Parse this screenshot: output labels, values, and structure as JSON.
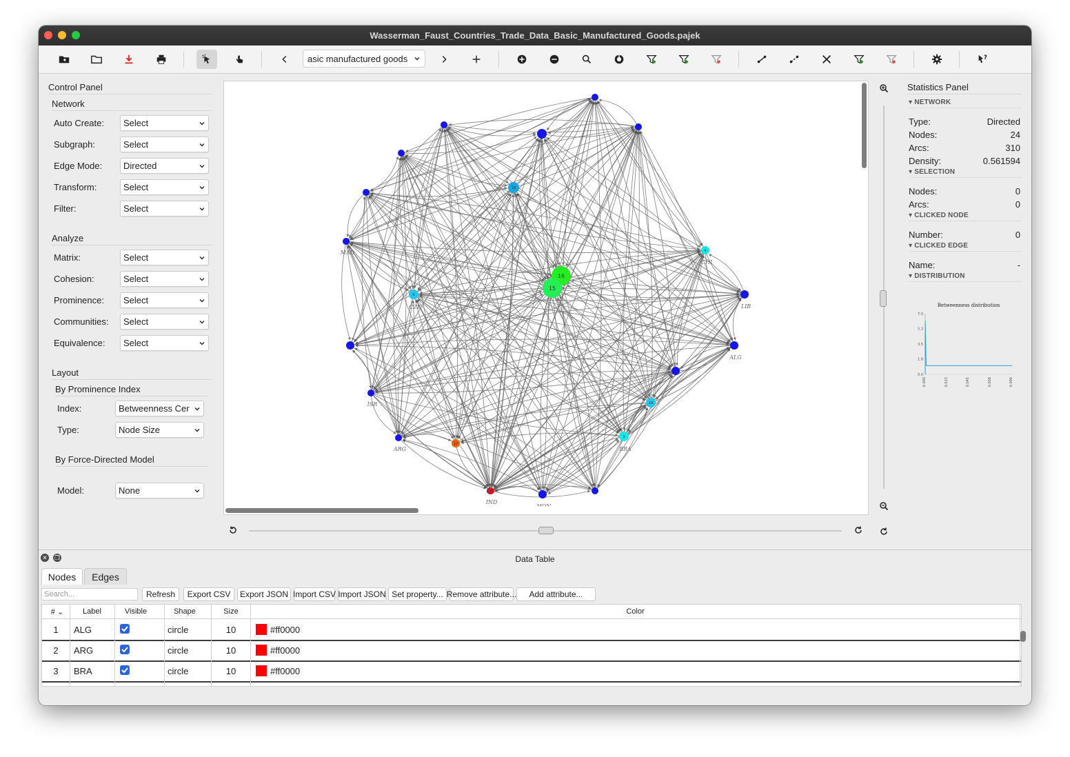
{
  "window": {
    "title": "Wasserman_Faust_Countries_Trade_Data_Basic_Manufactured_Goods.pajek"
  },
  "toolbar": {
    "network_select": "asic manufactured goods"
  },
  "control_panel": {
    "title": "Control Panel",
    "network": {
      "heading": "Network",
      "rows": [
        {
          "label": "Auto Create:",
          "value": "Select"
        },
        {
          "label": "Subgraph:",
          "value": "Select"
        },
        {
          "label": "Edge Mode:",
          "value": "Directed"
        },
        {
          "label": "Transform:",
          "value": "Select"
        },
        {
          "label": "Filter:",
          "value": "Select"
        }
      ]
    },
    "analyze": {
      "heading": "Analyze",
      "rows": [
        {
          "label": "Matrix:",
          "value": "Select"
        },
        {
          "label": "Cohesion:",
          "value": "Select"
        },
        {
          "label": "Prominence:",
          "value": "Select"
        },
        {
          "label": "Communities:",
          "value": "Select"
        },
        {
          "label": "Equivalence:",
          "value": "Select"
        }
      ]
    },
    "layout": {
      "heading": "Layout",
      "by_prominence": "By Prominence Index",
      "index_label": "Index:",
      "index_value": "Betweenness Cer",
      "type_label": "Type:",
      "type_value": "Node Size",
      "by_force": "By Force-Directed Model",
      "model_label": "Model:",
      "model_value": "None"
    }
  },
  "graph": {
    "nodes": [
      {
        "label": "",
        "num": "",
        "color": "#1616e6"
      },
      {
        "label": "",
        "num": "",
        "color": "#1616e6"
      },
      {
        "label": "",
        "num": "",
        "color": "#1616e6"
      },
      {
        "label": "",
        "num": "",
        "color": "#1616e6"
      },
      {
        "label": "",
        "num": "",
        "color": "#1616e6"
      },
      {
        "label": "MAD",
        "num": "",
        "color": "#1616e6"
      },
      {
        "label": "LIB",
        "num": "",
        "color": "#1616e6"
      },
      {
        "label": "",
        "num": "",
        "color": "#1616e6"
      },
      {
        "label": "ALG",
        "num": "",
        "color": "#1616e6"
      },
      {
        "label": "ISR",
        "num": "",
        "color": "#1616e6"
      },
      {
        "label": "ARG",
        "num": "",
        "color": "#1616e6"
      },
      {
        "label": "IND",
        "num": "",
        "color": "#1616e6"
      },
      {
        "label": "HON",
        "num": "",
        "color": "#1616e6"
      },
      {
        "label": "",
        "num": "",
        "color": "#1616e6"
      },
      {
        "label": "",
        "num": "",
        "color": "#1616e6"
      },
      {
        "label": "",
        "num": "",
        "color": "#1616e6"
      },
      {
        "label": "",
        "num": "19",
        "color": "#22c7ee"
      },
      {
        "label": "BRA",
        "num": "3",
        "color": "#18e6e6"
      },
      {
        "label": "CHI",
        "num": "4",
        "color": "#18e6e6"
      },
      {
        "label": "CZE",
        "num": "5",
        "color": "#22c7ee"
      },
      {
        "label": "",
        "num": "18",
        "color": "#1aa6e0"
      },
      {
        "label": "",
        "num": "16",
        "color": "#22ee22"
      },
      {
        "label": "",
        "num": "15",
        "color": "#22ee55"
      },
      {
        "label": "",
        "num": "22",
        "color": "#f2600c"
      },
      {
        "label": "",
        "num": "23",
        "color": "#f01414"
      }
    ]
  },
  "stats": {
    "title": "Statistics Panel",
    "network_header": "▾ NETWORK",
    "network_rows": [
      {
        "k": "Type:",
        "v": "Directed"
      },
      {
        "k": "Nodes:",
        "v": "24"
      },
      {
        "k": "Arcs:",
        "v": "310"
      },
      {
        "k": "Density:",
        "v": "0.561594"
      }
    ],
    "selection_header": "▾ SELECTION",
    "selection_rows": [
      {
        "k": "Nodes:",
        "v": "0"
      },
      {
        "k": "Arcs:",
        "v": "0"
      }
    ],
    "clicked_node_header": "▾ CLICKED NODE",
    "clicked_node_rows": [
      {
        "k": "Number:",
        "v": "0"
      }
    ],
    "clicked_edge_header": "▾ CLICKED EDGE",
    "clicked_edge_rows": [
      {
        "k": "Name:",
        "v": "-"
      }
    ],
    "distribution_header": "▾ DISTRIBUTION"
  },
  "chart_data": {
    "type": "line",
    "title": "Betweenness distribution",
    "x": [
      0.0,
      0.0,
      0.001,
      0.09
    ],
    "y": [
      0.0,
      6.2,
      1.0,
      1.0
    ],
    "xlim": [
      0.0,
      0.09
    ],
    "ylim": [
      0.0,
      7.0
    ],
    "xticks": [
      "0.000",
      "0.023",
      "0.045",
      "0.068",
      "0.090"
    ],
    "yticks": [
      "0.0",
      "1.8",
      "3.5",
      "5.3",
      "7.0"
    ],
    "line_color": "#2a9fd6"
  },
  "data_table": {
    "title": "Data Table",
    "tabs": [
      "Nodes",
      "Edges"
    ],
    "search_placeholder": "Search...",
    "buttons": [
      "Refresh",
      "Export CSV",
      "Export JSON",
      "Import CSV",
      "Import JSON",
      "Set property...",
      "Remove attribute...",
      "Add attribute..."
    ],
    "columns": [
      "#",
      "Label",
      "Visible",
      "Shape",
      "Size",
      "Color"
    ],
    "rows": [
      {
        "num": "1",
        "label": "ALG",
        "shape": "circle",
        "size": "10",
        "color": "#ff0000"
      },
      {
        "num": "2",
        "label": "ARG",
        "shape": "circle",
        "size": "10",
        "color": "#ff0000"
      },
      {
        "num": "3",
        "label": "BRA",
        "shape": "circle",
        "size": "10",
        "color": "#ff0000"
      }
    ]
  }
}
